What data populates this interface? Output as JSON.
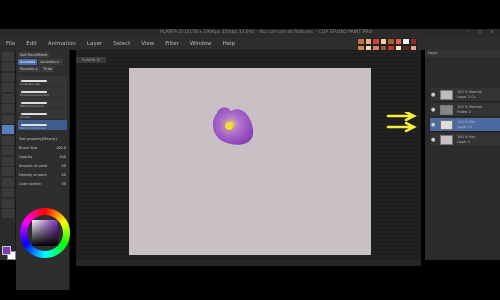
{
  "window": {
    "title": "PLANTA ZI (2178 x 1906px 350dpi 33.6%)  - You can use all features. - CLIP STUDIO PAINT PRO",
    "controls": [
      "–",
      "□",
      "×"
    ]
  },
  "menu": [
    "File",
    "Edit",
    "Animation",
    "Layer",
    "Select",
    "View",
    "Filter",
    "Window",
    "Help"
  ],
  "canvas_tab": "PLANTA ZI",
  "subtool": {
    "tabs": [
      "Soft Real/Wkest",
      "Acuarela",
      "Acuarela s.",
      "Pinceles s.",
      "Tinta"
    ],
    "brushes": [
      {
        "label": "Acuarela rala",
        "selected": false
      },
      {
        "label": "Pincel acuarela fino",
        "selected": false
      },
      {
        "label": "Mezcla humeda",
        "selected": false
      },
      {
        "label": "Grueso",
        "selected": false
      },
      {
        "label": "Mezcla fronteras",
        "selected": true
      }
    ],
    "tool_property_title": "Tool property[Mezcla]",
    "props": [
      {
        "name": "Brush Size",
        "value": "100.0"
      },
      {
        "name": "Opacity",
        "value": "100"
      },
      {
        "name": "Amount of paint",
        "value": "40"
      },
      {
        "name": "Density of paint",
        "value": "40"
      },
      {
        "name": "Color stretch",
        "value": "30"
      }
    ]
  },
  "colors": {
    "main": "#7a3db5",
    "sub": "#ffffff",
    "canvas": "#c9c0c6",
    "petal": "#a76fc9",
    "arrow": "#f4f03a"
  },
  "layers": {
    "header": "Layer",
    "rows": [
      {
        "line1": "100 % Normal",
        "line2": "Layer 2 Cc",
        "selected": false
      },
      {
        "line1": "100 % Normal",
        "line2": "Folder 2",
        "selected": false
      },
      {
        "line1": "100 % Nor",
        "line2": "Layer 11",
        "selected": true
      },
      {
        "line1": "100 % Nor",
        "line2": "Layer 1",
        "selected": false
      }
    ]
  }
}
